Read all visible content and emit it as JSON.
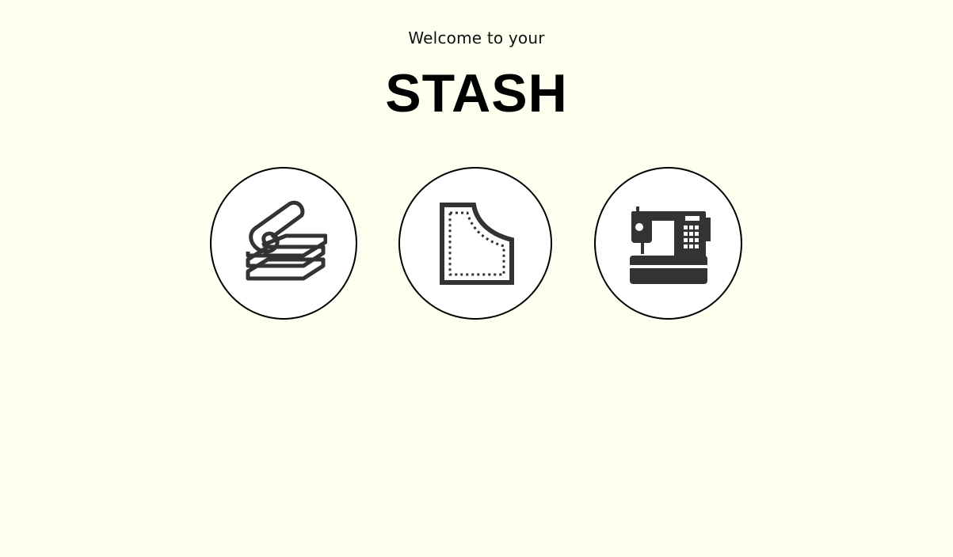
{
  "header": {
    "welcome_text": "Welcome to your",
    "brand_title": "STASH"
  },
  "nav_buttons": [
    {
      "id": "fabric",
      "icon": "fabric-stack-icon"
    },
    {
      "id": "patterns",
      "icon": "sewing-pattern-icon"
    },
    {
      "id": "machines",
      "icon": "sewing-machine-icon"
    }
  ],
  "colors": {
    "background": "#FFFFF0",
    "icon": "#333333",
    "outline": "#000000"
  }
}
